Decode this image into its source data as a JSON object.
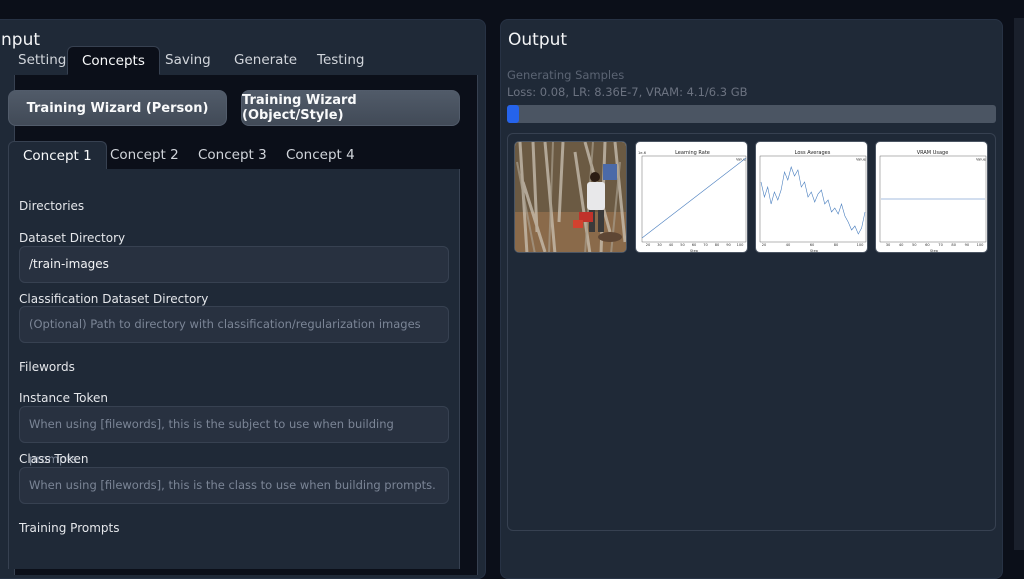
{
  "input_panel": {
    "title": "Input",
    "tabs": [
      "Settings",
      "Concepts",
      "Saving",
      "Generate",
      "Testing"
    ],
    "active_tab": "Concepts",
    "wizard_person_label": "Training Wizard (Person)",
    "wizard_object_label": "Training Wizard (Object/Style)",
    "concept_tabs": [
      "Concept 1",
      "Concept 2",
      "Concept 3",
      "Concept 4"
    ],
    "active_concept": "Concept 1",
    "sections": {
      "directories": "Directories",
      "filewords": "Filewords",
      "training_prompts": "Training Prompts"
    },
    "fields": {
      "dataset_dir_label": "Dataset Directory",
      "dataset_dir_value": "/train-images",
      "class_dir_label": "Classification Dataset Directory",
      "class_dir_placeholder": "(Optional) Path to directory with classification/regularization images",
      "instance_token_label": "Instance Token",
      "instance_token_placeholder": "When using [filewords], this is the subject to use when building prompts.",
      "class_token_label": "Class Token",
      "class_token_placeholder": "When using [filewords], this is the class to use when building prompts."
    }
  },
  "output_panel": {
    "title": "Output",
    "status_title": "Generating Samples",
    "status_line": "Loss: 0.08, LR: 8.36E-7, VRAM: 4.1/6.3 GB",
    "progress_fraction": 0.025,
    "progress_color": "#2563eb",
    "gallery": [
      {
        "type": "photo"
      },
      {
        "type": "chart",
        "title": "Learning Rate",
        "xlabel": "Step",
        "xticks": [
          "20",
          "30",
          "40",
          "50",
          "60",
          "70",
          "80",
          "90",
          "100"
        ],
        "ytop": "1e-6",
        "series": "Value",
        "kind": "rising"
      },
      {
        "type": "chart",
        "title": "Loss Averages",
        "xlabel": "Step",
        "xticks": [
          "20",
          "40",
          "60",
          "80",
          "100"
        ],
        "series": "Value",
        "kind": "noisy"
      },
      {
        "type": "chart",
        "title": "VRAM Usage",
        "xlabel": "Step",
        "xticks": [
          "30",
          "40",
          "50",
          "60",
          "70",
          "80",
          "90",
          "100"
        ],
        "series": "Value",
        "kind": "flat"
      }
    ]
  },
  "colors": {
    "background": "#0b0f19",
    "panel": "#1f2937",
    "accent": "#2563eb",
    "line": "#4a7fbf"
  }
}
